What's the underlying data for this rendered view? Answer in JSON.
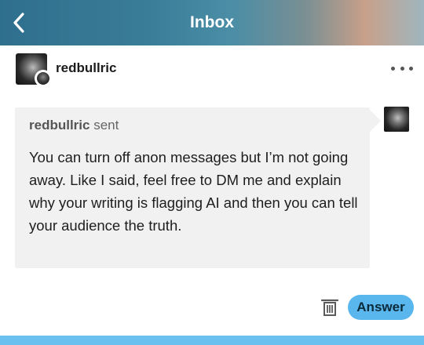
{
  "header": {
    "title": "Inbox",
    "back_icon": "chevron-left-icon"
  },
  "post": {
    "username": "redbullric",
    "more_icon": "ellipsis-icon",
    "sender_name": "redbullric",
    "sent_label": "sent",
    "message": "You can turn off anon messages but I’m not going away. Like I said, feel free to DM me and explain why your writing is flagging AI and then you can tell your audience the truth."
  },
  "actions": {
    "delete_icon": "trash-icon",
    "answer_label": "Answer"
  },
  "colors": {
    "accent": "#5ab7ee",
    "bubble": "#f1f1f1",
    "bottom_bar": "#6ac1f0"
  }
}
